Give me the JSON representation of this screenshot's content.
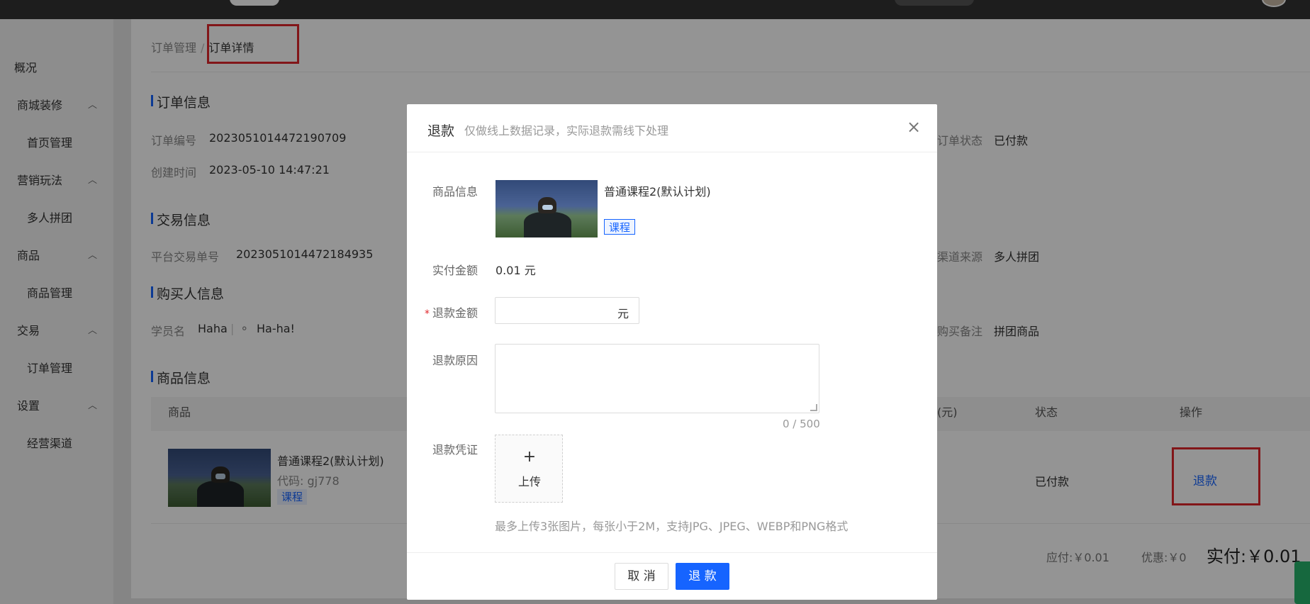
{
  "sidebar": {
    "items": [
      {
        "label": "概况",
        "type": "top"
      },
      {
        "label": "商城装修",
        "type": "group"
      },
      {
        "label": "首页管理",
        "type": "child"
      },
      {
        "label": "营销玩法",
        "type": "group"
      },
      {
        "label": "多人拼团",
        "type": "child"
      },
      {
        "label": "商品",
        "type": "group"
      },
      {
        "label": "商品管理",
        "type": "child"
      },
      {
        "label": "交易",
        "type": "group"
      },
      {
        "label": "订单管理",
        "type": "child"
      },
      {
        "label": "设置",
        "type": "group"
      },
      {
        "label": "经营渠道",
        "type": "child"
      }
    ]
  },
  "breadcrumb": {
    "parent": "订单管理",
    "separator": "/",
    "current": "订单详情"
  },
  "order_info": {
    "title": "订单信息",
    "order_no_label": "订单编号",
    "order_no": "2023051014472190709",
    "created_label": "创建时间",
    "created": "2023-05-10 14:47:21",
    "status_label": "订单状态",
    "status": "已付款"
  },
  "trade_info": {
    "title": "交易信息",
    "platform_no_label": "平台交易单号",
    "platform_no": "2023051014472184935",
    "channel_label": "渠道来源",
    "channel": "多人拼团"
  },
  "buyer_info": {
    "title": "购买人信息",
    "student_label": "学员名",
    "student": "Haha",
    "nickname": "Ha-ha!",
    "remark_label": "购买备注",
    "remark": "拼团商品"
  },
  "goods_info": {
    "title": "商品信息",
    "columns": {
      "goods": "商品",
      "price": "(元)",
      "status": "状态",
      "action": "操作"
    },
    "row": {
      "name": "普通课程2(默认计划)",
      "code": "代码: gj778",
      "tag": "课程",
      "status": "已付款",
      "action": "退款"
    }
  },
  "summary": {
    "payable": "应付:￥0.01",
    "discount": "优惠:￥0",
    "paid": "实付:￥0.01"
  },
  "modal": {
    "title": "退款",
    "subtitle": "仅做线上数据记录，实际退款需线下处理",
    "close_icon": "×",
    "goods_label": "商品信息",
    "goods_name": "普通课程2(默认计划)",
    "goods_tag": "课程",
    "paid_label": "实付金额",
    "paid_value": "0.01 元",
    "refund_amount_label": "退款金额",
    "refund_amount_required": "*",
    "refund_amount_value": "",
    "refund_amount_unit": "元",
    "reason_label": "退款原因",
    "reason_value": "",
    "reason_counter": "0 / 500",
    "proof_label": "退款凭证",
    "upload_plus": "+",
    "upload_label": "上传",
    "upload_hint": "最多上传3张图片，每张小于2M，支持JPG、JPEG、WEBP和PNG格式",
    "cancel_label": "取 消",
    "confirm_label": "退 款"
  },
  "colors": {
    "accent": "#1664ff",
    "highlight_box": "#e0262b",
    "required": "#e0262b"
  }
}
